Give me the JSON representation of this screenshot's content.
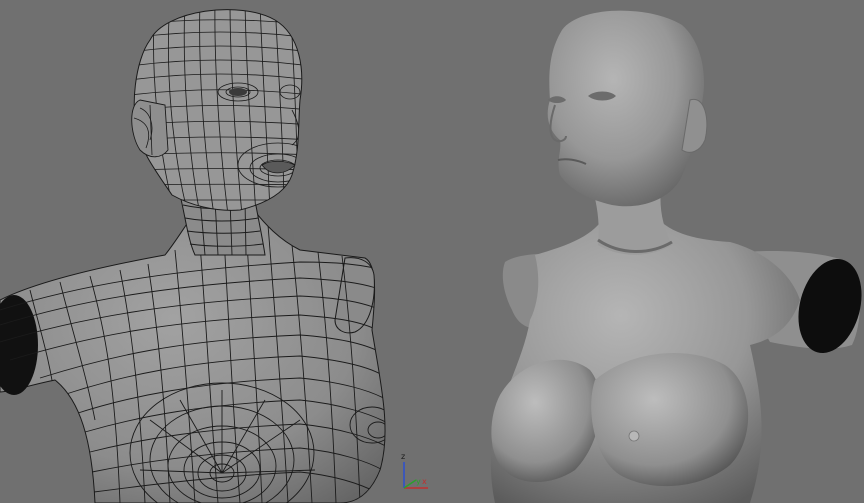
{
  "viewport": {
    "background": "#707070",
    "wire_color": "#1a1a1a",
    "mesh_fill": "#8d8d8d",
    "shaded_fill": "#9a9a9a"
  },
  "axis_gizmo": {
    "z_label": "z",
    "x_label": "x",
    "y_label": "y",
    "x_color": "#c03030",
    "y_color": "#2ca02c",
    "z_color": "#2a4fd0"
  },
  "objects": [
    {
      "name": "wireframe-bust",
      "display": "wireframe-on-shaded"
    },
    {
      "name": "smooth-bust",
      "display": "smooth-shaded"
    }
  ]
}
